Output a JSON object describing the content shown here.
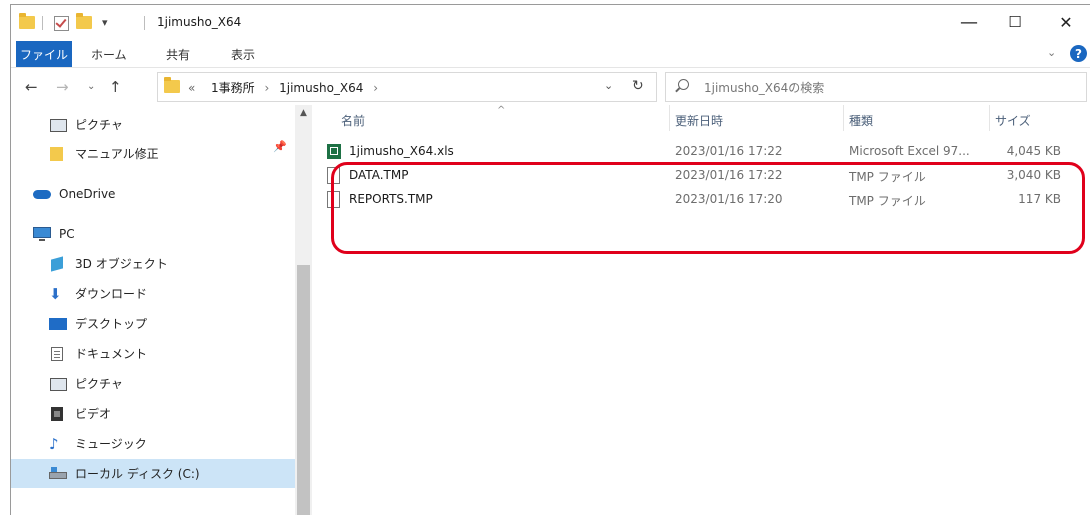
{
  "window": {
    "title": "1jimusho_X64",
    "controls": {
      "minimize": "—",
      "maximize": "☐",
      "close": "✕"
    }
  },
  "quick_access": {
    "dropdown_glyph": "▾"
  },
  "ribbon": {
    "tabs": [
      "ファイル",
      "ホーム",
      "共有",
      "表示"
    ],
    "help": "?"
  },
  "address": {
    "path_prefix": "«",
    "path": [
      "1事務所",
      "1jimusho_X64"
    ],
    "sep": "›",
    "search_placeholder": "1jimusho_X64の検索"
  },
  "nav": {
    "items": [
      {
        "label": "ピクチャ",
        "icon": "pictures-icon"
      },
      {
        "label": "マニュアル修正",
        "icon": "folder-icon"
      },
      {
        "label": "OneDrive",
        "icon": "onedrive-icon"
      },
      {
        "label": "PC",
        "icon": "pc-icon"
      },
      {
        "label": "3D オブジェクト",
        "icon": "3d-objects-icon"
      },
      {
        "label": "ダウンロード",
        "icon": "download-icon"
      },
      {
        "label": "デスクトップ",
        "icon": "desktop-icon"
      },
      {
        "label": "ドキュメント",
        "icon": "documents-icon"
      },
      {
        "label": "ピクチャ",
        "icon": "pictures-icon"
      },
      {
        "label": "ビデオ",
        "icon": "video-icon"
      },
      {
        "label": "ミュージック",
        "icon": "music-icon"
      },
      {
        "label": "ローカル ディスク (C:)",
        "icon": "local-disk-icon"
      }
    ],
    "selected": "ローカル ディスク (C:)"
  },
  "columns": {
    "name": "名前",
    "modified": "更新日時",
    "type": "種類",
    "size": "サイズ"
  },
  "files": [
    {
      "name": "1jimusho_X64.xls",
      "modified": "2023/01/16 17:22",
      "type": "Microsoft Excel 97...",
      "size": "4,045 KB",
      "icon": "excel-file-icon"
    },
    {
      "name": "DATA.TMP",
      "modified": "2023/01/16 17:22",
      "type": "TMP ファイル",
      "size": "3,040 KB",
      "icon": "generic-file-icon"
    },
    {
      "name": "REPORTS.TMP",
      "modified": "2023/01/16 17:20",
      "type": "TMP ファイル",
      "size": "117 KB",
      "icon": "generic-file-icon"
    }
  ],
  "colors": {
    "accent": "#1a67c0",
    "highlight": "#e0001b",
    "selection": "#cce4f7"
  }
}
